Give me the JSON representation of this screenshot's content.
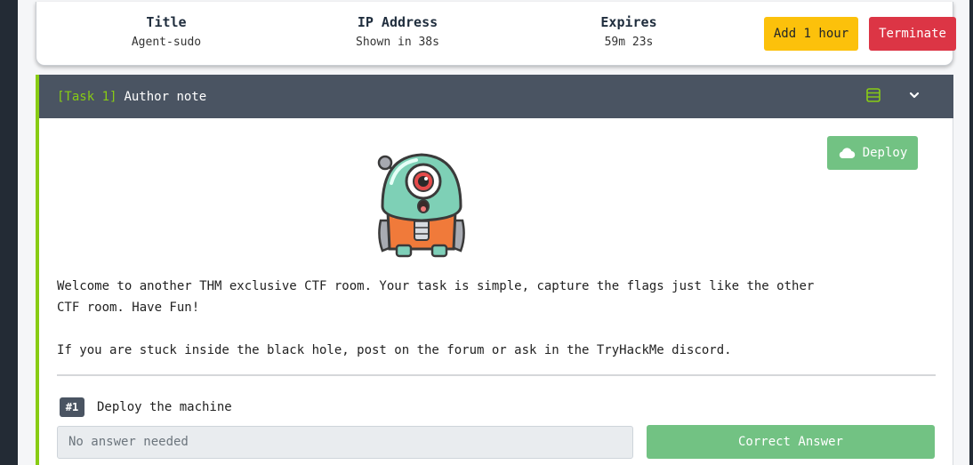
{
  "machine": {
    "title_label": "Title",
    "title_value": "Agent-sudo",
    "ip_label": "IP Address",
    "ip_value": "Shown in 38s",
    "expires_label": "Expires",
    "expires_value": "59m 23s",
    "add_hour_label": "Add 1 hour",
    "terminate_label": "Terminate"
  },
  "task": {
    "tag": "[Task 1]",
    "title": "Author note",
    "deploy_label": "Deploy",
    "paragraph1": "Welcome to another THM exclusive CTF room. Your task is simple, capture the flags just like the other CTF room. Have Fun!",
    "paragraph2": "If you are stuck inside the black hole, post on the forum or ask in the TryHackMe discord.",
    "question": {
      "number": "#1",
      "text": "Deploy the machine",
      "answer_placeholder": "No answer needed",
      "submit_label": "Correct Answer"
    }
  },
  "colors": {
    "accent_green": "#88cc14",
    "header_bg": "#4a5462",
    "warning": "#fcc10b",
    "danger": "#dc3545",
    "success": "#72c283"
  },
  "icons": [
    "list-icon",
    "chevron-down-icon",
    "cloud-icon",
    "mascot-image"
  ]
}
